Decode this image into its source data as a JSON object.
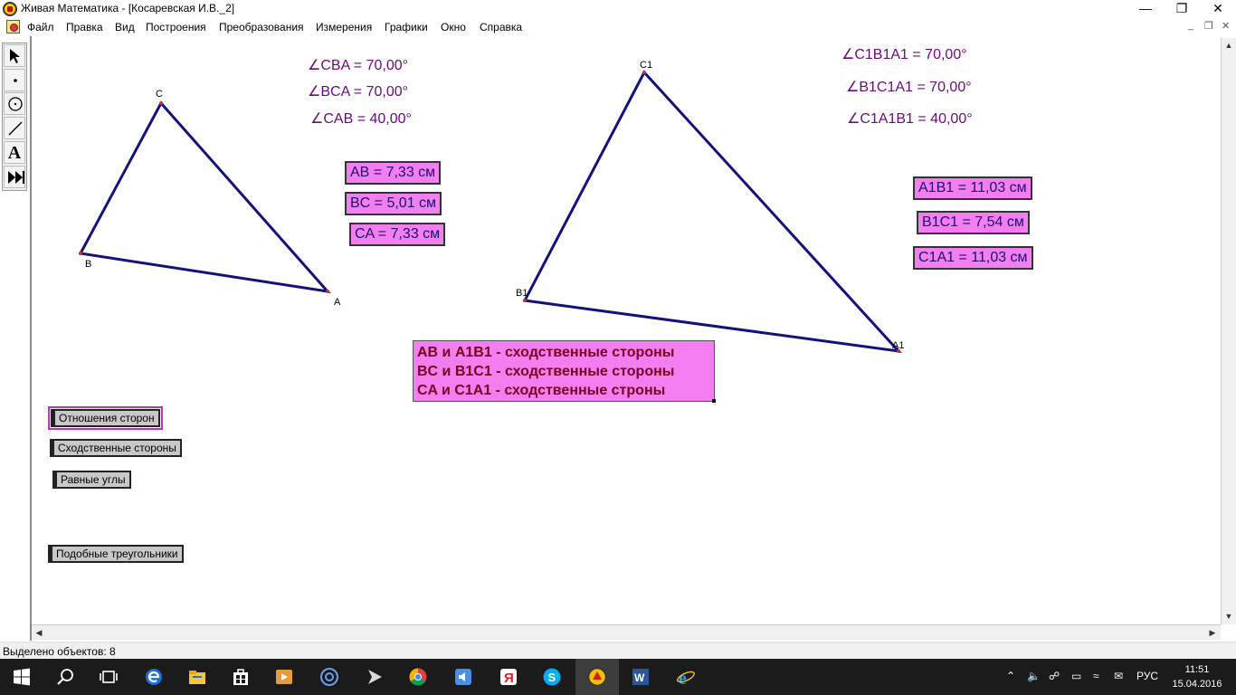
{
  "window": {
    "title": "Живая Математика - [Косаревская И.В._2]"
  },
  "menu": [
    "Файл",
    "Правка",
    "Вид",
    "Построения",
    "Преобразования",
    "Измерения",
    "Графики",
    "Окно",
    "Справка"
  ],
  "toolbox": {
    "tools": [
      "selection-arrow-tool",
      "point-tool",
      "compass-tool",
      "straightedge-tool",
      "text-tool",
      "custom-tool"
    ],
    "text_tool_glyph": "A"
  },
  "triangle1": {
    "vertices": {
      "A": "A",
      "B": "B",
      "C": "C"
    }
  },
  "triangle2": {
    "vertices": {
      "A": "A1",
      "B": "B1",
      "C": "C1"
    }
  },
  "angles1": [
    "∠CBA = 70,00°",
    "∠BCA = 70,00°",
    "∠CAB = 40,00°"
  ],
  "angles2": [
    "∠C1B1A1 = 70,00°",
    "∠B1C1A1 = 70,00°",
    "∠C1A1B1 = 40,00°"
  ],
  "lengths1": [
    "AB = 7,33 см",
    "BC = 5,01 см",
    "CA = 7,33 см"
  ],
  "lengths2": [
    "A1B1 = 11,03 см",
    "B1C1 = 7,54 см",
    "C1A1 = 11,03 см"
  ],
  "note": [
    "AB и A1B1 - сходственные стороны",
    "BC и B1C1 - сходственные стороны",
    "CA и C1A1 - сходственные строны"
  ],
  "action_buttons": [
    "Отношения сторон",
    "Сходственные стороны",
    "Равные углы",
    "Подобные треугольники"
  ],
  "status": "Выделено объектов: 8",
  "taskbar": {
    "apps": [
      "windows-start",
      "search",
      "task-view",
      "edge",
      "file-explorer",
      "store",
      "media-player",
      "at-app",
      "arrow-app",
      "chrome",
      "audio-app",
      "yandex",
      "skype",
      "live-math",
      "word",
      "internet-explorer"
    ],
    "tray": {
      "lang": "РУС",
      "time": "11:51",
      "date": "15.04.2016"
    }
  },
  "colors": {
    "figure_line": "#12127a",
    "measure_text": "#6a0a7a",
    "box_fill": "#f27ef0",
    "box_text": "#1c1070",
    "note_text": "#7a0020",
    "taskbar": "#1b1b1b"
  }
}
